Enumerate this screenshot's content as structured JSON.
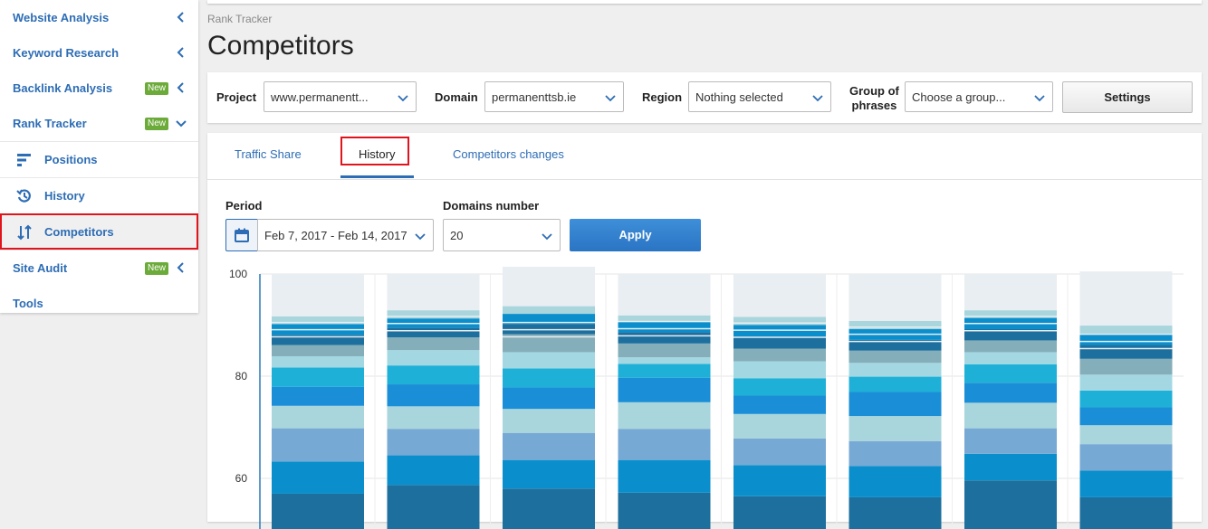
{
  "sidebar": {
    "items": [
      {
        "label": "Website Analysis",
        "badge": "",
        "chevron": "left"
      },
      {
        "label": "Keyword Research",
        "badge": "",
        "chevron": "left"
      },
      {
        "label": "Backlink Analysis",
        "badge": "New",
        "chevron": "left"
      },
      {
        "label": "Rank Tracker",
        "badge": "New",
        "chevron": "down"
      }
    ],
    "sub_items": [
      {
        "label": "Positions",
        "icon": "positions-icon"
      },
      {
        "label": "History",
        "icon": "history-icon"
      },
      {
        "label": "Competitors",
        "icon": "sort-arrows-icon",
        "active": true
      }
    ],
    "bottom_items": [
      {
        "label": "Site Audit",
        "badge": "New",
        "chevron": "left"
      },
      {
        "label": "Tools",
        "badge": "",
        "chevron": ""
      }
    ]
  },
  "breadcrumb": "Rank Tracker",
  "page_title": "Competitors",
  "filters": {
    "project_label": "Project",
    "project_value": "www.permanentt...",
    "domain_label": "Domain",
    "domain_value": "permanenttsb.ie",
    "region_label": "Region",
    "region_value": "Nothing selected",
    "group_label_1": "Group of",
    "group_label_2": "phrases",
    "group_value": "Choose a group...",
    "settings_label": "Settings"
  },
  "tabs": [
    {
      "label": "Traffic Share"
    },
    {
      "label": "History",
      "active": true
    },
    {
      "label": "Competitors changes"
    }
  ],
  "controls": {
    "period_label": "Period",
    "period_value": "Feb 7, 2017 - Feb 14, 2017",
    "domains_label": "Domains number",
    "domains_value": "20",
    "apply_label": "Apply"
  },
  "colors": {
    "accent": "#2d6db5",
    "badge_green": "#6cab3a",
    "highlight_red": "#e0141c",
    "segment_palette": [
      "#1d6f9e",
      "#0a8fcc",
      "#76a9d4",
      "#a9d5dc",
      "#1a8ed6",
      "#1fb0d8",
      "#a3d8e3",
      "#84aeb9",
      "#1d6f9e",
      "#0a8fcc",
      "#a9d5dc",
      "#e8eef2"
    ]
  },
  "chart_data": {
    "type": "bar",
    "stacked": true,
    "categories": [
      "",
      "",
      "",
      "",
      "",
      "",
      "",
      ""
    ],
    "ylim": [
      55,
      100
    ],
    "yticks": [
      100,
      80,
      60
    ],
    "series": [
      {
        "values": [
          57,
          58.7,
          58,
          57.2,
          56.5,
          56.3,
          59.6,
          56.3
        ]
      },
      {
        "values": [
          6.3,
          5.8,
          5.6,
          6.4,
          6.1,
          6.1,
          5.2,
          5.2
        ]
      },
      {
        "values": [
          6.5,
          5.2,
          5.3,
          6.1,
          5.2,
          4.9,
          5.0,
          5.2
        ]
      },
      {
        "values": [
          4.4,
          4.4,
          4.7,
          5.2,
          4.8,
          4.9,
          5.0,
          3.7
        ]
      },
      {
        "values": [
          3.7,
          4.3,
          4.2,
          4.8,
          3.6,
          4.7,
          3.9,
          3.5
        ]
      },
      {
        "values": [
          3.8,
          3.7,
          3.7,
          2.7,
          3.4,
          3.0,
          3.6,
          3.3
        ]
      },
      {
        "values": [
          2.2,
          3.0,
          3.2,
          1.3,
          3.3,
          2.7,
          2.4,
          3.1
        ]
      },
      {
        "values": [
          2.2,
          2.5,
          3.5,
          2.7,
          2.5,
          2.4,
          2.3,
          3.1
        ]
      },
      {
        "values": [
          2.0,
          1.9,
          2.0,
          2.2,
          2.3,
          2.1,
          2.2,
          2.7
        ]
      },
      {
        "values": [
          2.1,
          1.8,
          2.0,
          2.0,
          2.3,
          2.1,
          2.2,
          2.2
        ]
      },
      {
        "values": [
          1.5,
          1.6,
          1.5,
          1.3,
          1.6,
          1.6,
          1.5,
          1.6
        ]
      },
      {
        "values": [
          8.3,
          7.1,
          8.3,
          8.1,
          8.4,
          9.2,
          7.1,
          10.6
        ]
      }
    ]
  }
}
